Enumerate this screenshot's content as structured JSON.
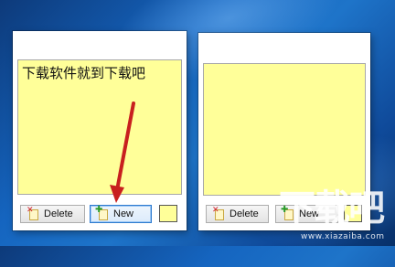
{
  "colors": {
    "note_background": "#ffff99",
    "arrow": "#c8201f"
  },
  "notes": [
    {
      "text": "下载软件就到下载吧",
      "delete_label": "Delete",
      "new_label": "New",
      "new_focused": true
    },
    {
      "text": "",
      "delete_label": "Delete",
      "new_label": "New",
      "new_focused": false
    }
  ],
  "icons": {
    "delete": "delete-note-icon",
    "new": "new-note-icon"
  },
  "watermark": {
    "text": "下载吧",
    "url": "www.xiazaiba.com"
  }
}
